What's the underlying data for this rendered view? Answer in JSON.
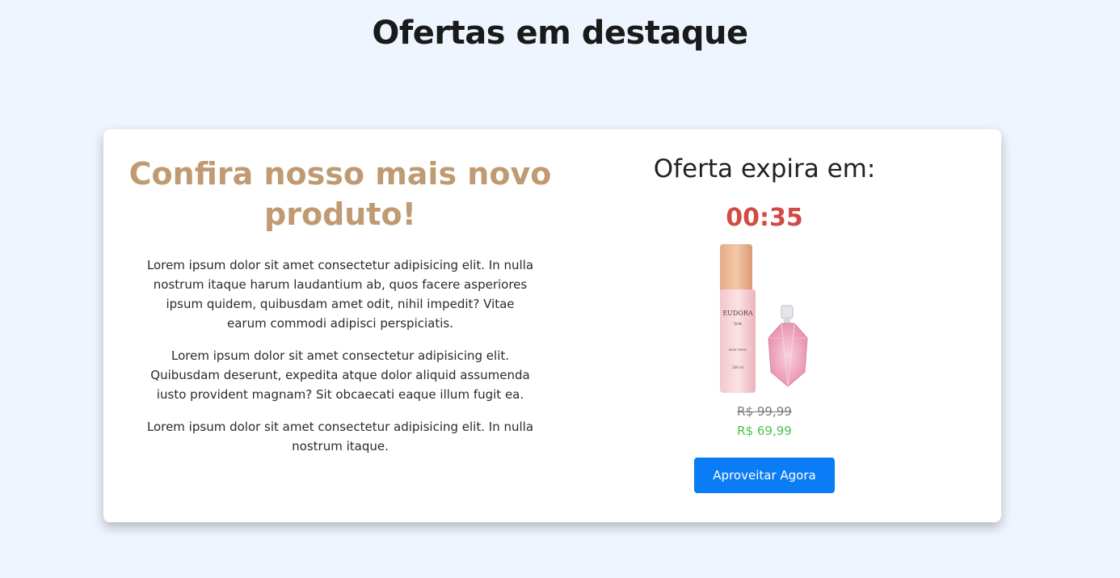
{
  "header": {
    "title": "Ofertas em destaque"
  },
  "promo": {
    "heading": "Confira nosso mais novo produto!",
    "paragraphs": [
      "Lorem ipsum dolor sit amet consectetur adipisicing elit. In nulla nostrum itaque harum laudantium ab, quos facere asperiores ipsum quidem, quibusdam amet odit, nihil impedit? Vitae earum commodi adipisci perspiciatis.",
      "Lorem ipsum dolor sit amet consectetur adipisicing elit. Quibusdam deserunt, expedita atque dolor aliquid assumenda iusto provident magnam? Sit obcaecati eaque illum fugit ea.",
      "Lorem ipsum dolor sit amet consectetur adipisicing elit. In nulla nostrum itaque."
    ]
  },
  "offer": {
    "expire_label": "Oferta expira em:",
    "timer": "00:35",
    "product": {
      "brand": "EUDORA",
      "sub": "lyra",
      "spray_label": "BODY SPRAY",
      "volume": "100 ml"
    },
    "old_price": "R$ 99,99",
    "new_price": "R$ 69,99",
    "cta_label": "Aproveitar Agora"
  },
  "colors": {
    "background": "#eef5ff",
    "heading_accent": "#bf9a72",
    "timer": "#d24a45",
    "new_price": "#4cc24c",
    "cta": "#0a7cf5"
  }
}
